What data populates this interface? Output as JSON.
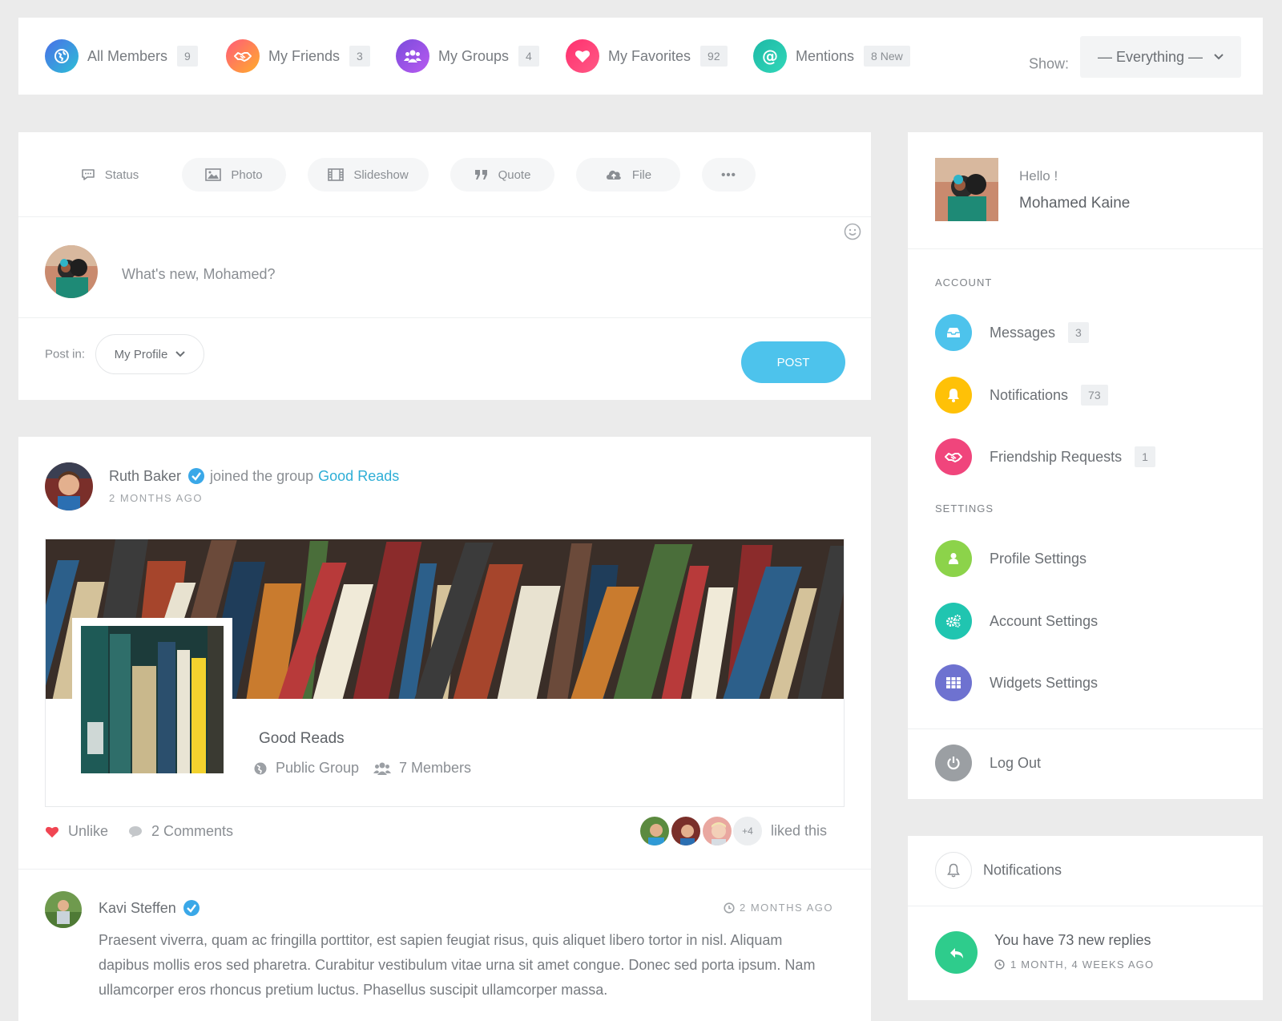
{
  "filters": [
    {
      "label": "All Members",
      "count": "9",
      "icon": "globe-icon",
      "gradient": [
        "#4a6fe8",
        "#2dbfd6"
      ]
    },
    {
      "label": "My Friends",
      "count": "3",
      "icon": "handshake-icon",
      "gradient": [
        "#ff5a7a",
        "#ffae2b"
      ]
    },
    {
      "label": "My Groups",
      "count": "4",
      "icon": "users-icon",
      "gradient": [
        "#7b4bdc",
        "#b85bf0"
      ]
    },
    {
      "label": "My Favorites",
      "count": "92",
      "icon": "heart-icon",
      "gradient": [
        "#ff2f6e",
        "#ff5a86"
      ]
    },
    {
      "label": "Mentions",
      "count": "8 New",
      "icon": "at-icon",
      "gradient": [
        "#1db9a6",
        "#32d7b9"
      ]
    }
  ],
  "show": {
    "label": "Show:",
    "value": "— Everything —"
  },
  "composer": {
    "types": [
      {
        "label": "Status",
        "icon": "speech-bubble-icon"
      },
      {
        "label": "Photo",
        "icon": "image-icon"
      },
      {
        "label": "Slideshow",
        "icon": "film-icon"
      },
      {
        "label": "Quote",
        "icon": "quote-icon"
      },
      {
        "label": "File",
        "icon": "cloud-upload-icon"
      },
      {
        "label": "•••",
        "icon": "more-icon"
      }
    ],
    "placeholder": "What's new, Mohamed?",
    "post_in_label": "Post in:",
    "post_in_value": "My Profile",
    "post_button": "POST"
  },
  "activity": {
    "author": "Ruth Baker",
    "action": "joined the group",
    "group_link": "Good Reads",
    "time": "2 MONTHS AGO",
    "group": {
      "title": "Good Reads",
      "type": "Public Group",
      "members": "7 Members"
    },
    "unlike": "Unlike",
    "comments": "2 Comments",
    "more_likers": "+4",
    "liked_this": "liked this",
    "comment": {
      "author": "Kavi Steffen",
      "time": "2 MONTHS AGO",
      "text": "Praesent viverra, quam ac fringilla porttitor, est sapien feugiat risus, quis aliquet libero tortor in nisl. Aliquam dapibus mollis eros sed pharetra. Curabitur vestibulum vitae urna sit amet congue. Donec sed porta ipsum. Nam ullamcorper eros rhoncus pretium luctus. Phasellus suscipit ullamcorper massa."
    }
  },
  "sidebar": {
    "hello": "Hello !",
    "name": "Mohamed Kaine",
    "account_label": "ACCOUNT",
    "account_items": [
      {
        "label": "Messages",
        "count": "3",
        "icon": "inbox-icon",
        "color": "#4dc3ec"
      },
      {
        "label": "Notifications",
        "count": "73",
        "icon": "bell-icon",
        "color": "#ffc107"
      },
      {
        "label": "Friendship Requests",
        "count": "1",
        "icon": "handshake-icon",
        "color": "#f0457c"
      }
    ],
    "settings_label": "SETTINGS",
    "settings_items": [
      {
        "label": "Profile Settings",
        "icon": "user-icon",
        "color": "#8cd34a"
      },
      {
        "label": "Account Settings",
        "icon": "gears-icon",
        "color": "#20c5b0"
      },
      {
        "label": "Widgets Settings",
        "icon": "grid-icon",
        "color": "#6e72d0"
      }
    ],
    "logout": {
      "label": "Log Out",
      "icon": "power-icon",
      "color": "#9b9fa3"
    }
  },
  "notifications_widget": {
    "title": "Notifications",
    "item_text": "You have 73 new replies",
    "item_time": "1 MONTH, 4 WEEKS AGO"
  }
}
